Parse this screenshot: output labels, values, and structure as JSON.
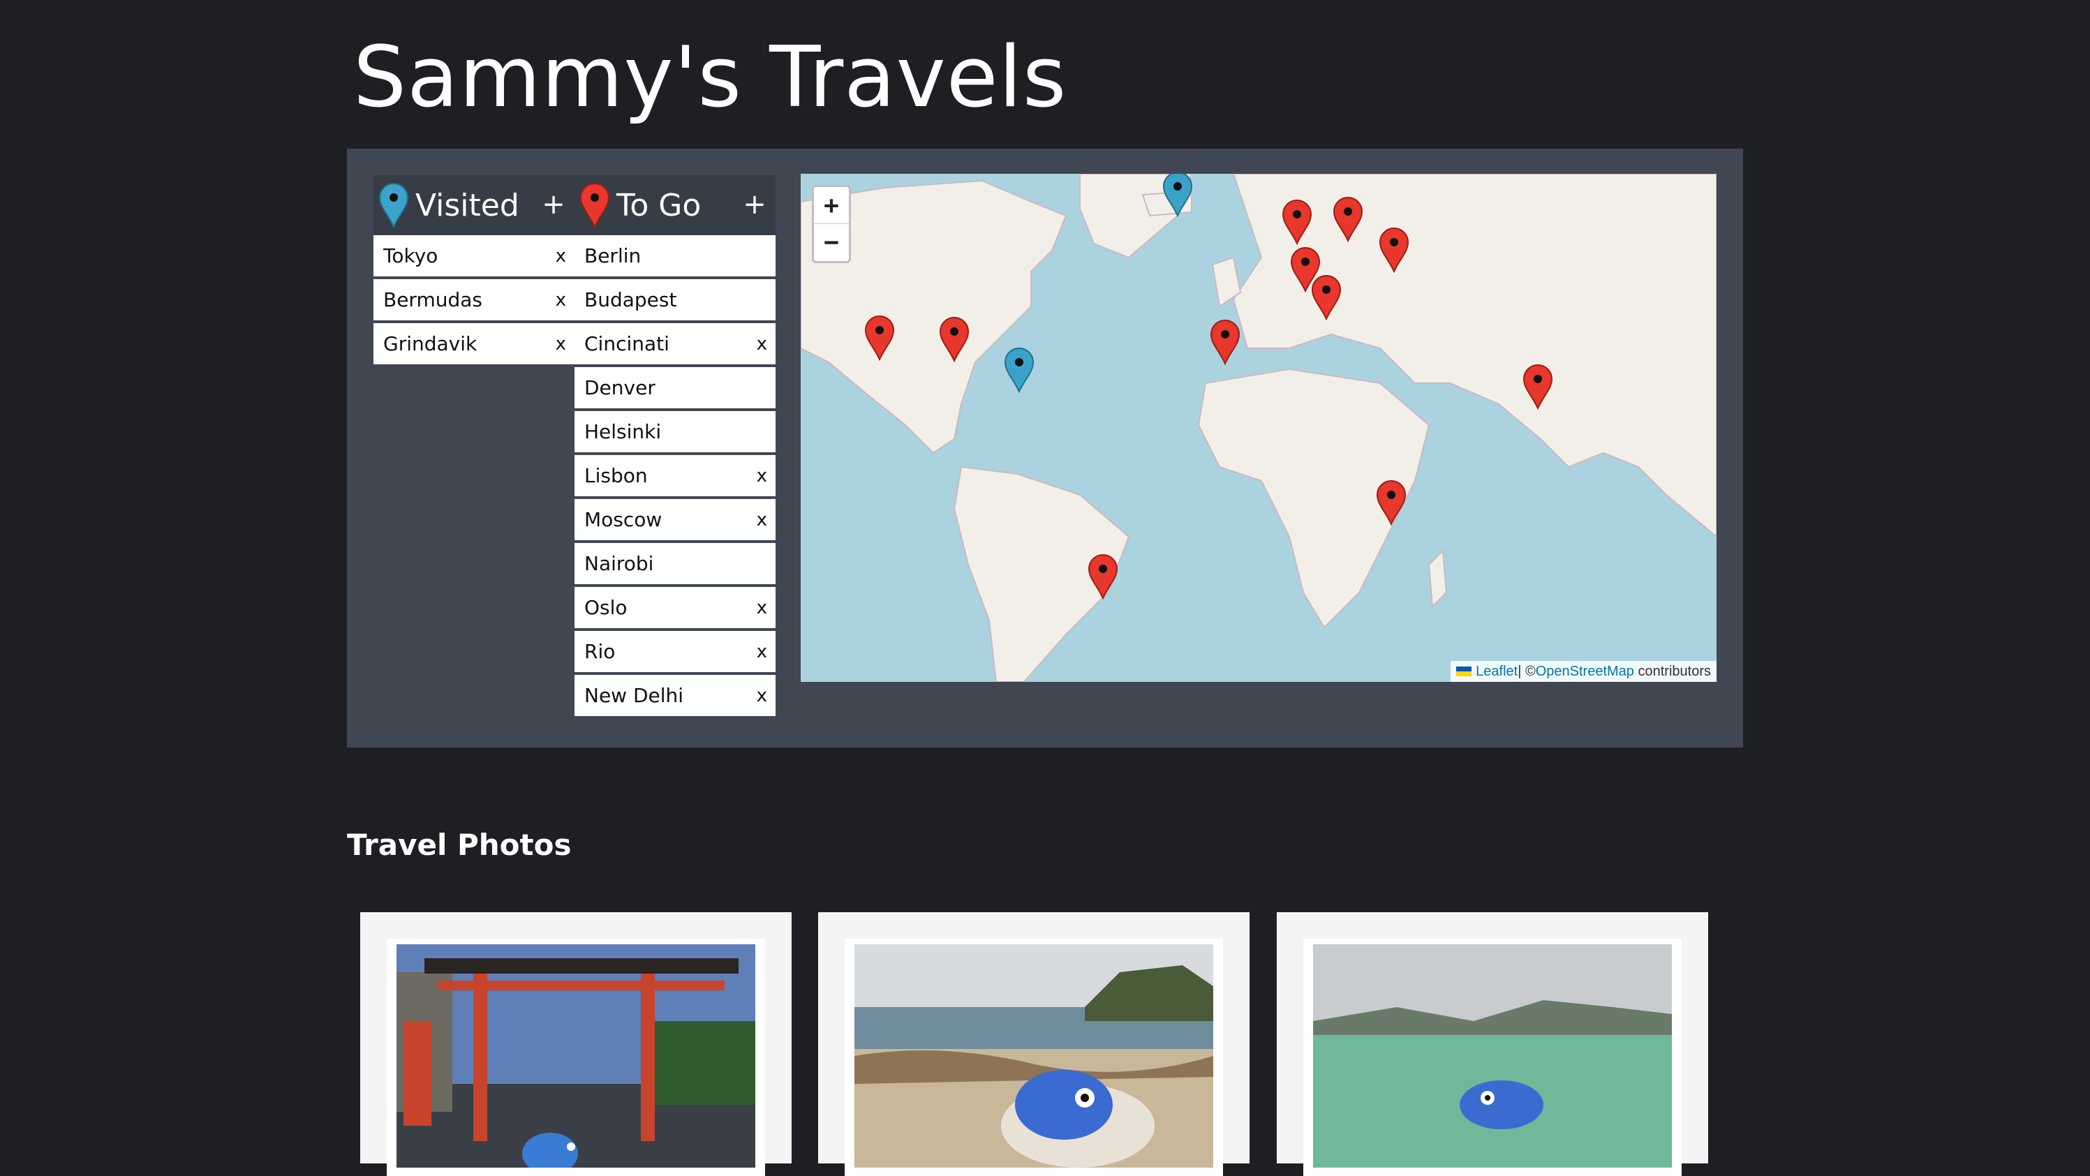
{
  "page": {
    "title": "Sammy's Travels"
  },
  "visited": {
    "header": "Visited",
    "add_label": "+",
    "items": [
      {
        "label": "Tokyo",
        "remove": "x"
      },
      {
        "label": "Bermudas",
        "remove": "x"
      },
      {
        "label": "Grindavik",
        "remove": "x"
      }
    ]
  },
  "togo": {
    "header": "To Go",
    "add_label": "+",
    "items": [
      {
        "label": "Berlin",
        "remove": ""
      },
      {
        "label": "Budapest",
        "remove": ""
      },
      {
        "label": "Cincinati",
        "remove": "x"
      },
      {
        "label": "Denver",
        "remove": ""
      },
      {
        "label": "Helsinki",
        "remove": ""
      },
      {
        "label": "Lisbon",
        "remove": "x"
      },
      {
        "label": "Moscow",
        "remove": "x"
      },
      {
        "label": "Nairobi",
        "remove": ""
      },
      {
        "label": "Oslo",
        "remove": "x"
      },
      {
        "label": "Rio",
        "remove": "x"
      },
      {
        "label": "New Delhi",
        "remove": "x"
      }
    ]
  },
  "map": {
    "zoom_in": "+",
    "zoom_out": "−",
    "attribution": {
      "leaflet": "Leaflet",
      "sep": " | © ",
      "osm": "OpenStreetMap",
      "suffix": " contributors"
    },
    "colors": {
      "water": "#aad3df",
      "land": "#f2efe9",
      "visited_pin": "#3ba3c9",
      "togo_pin": "#e8372c"
    }
  },
  "photos": {
    "section_title": "Travel Photos"
  }
}
